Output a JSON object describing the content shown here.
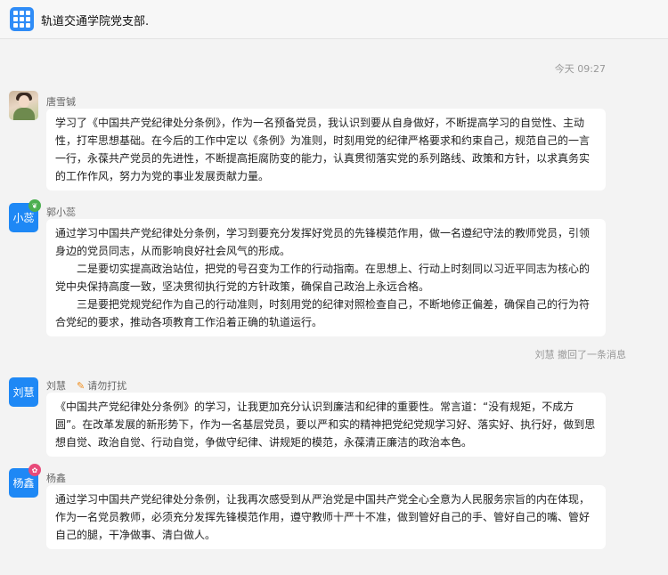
{
  "header": {
    "title": "轨道交通学院党支部.",
    "icon": "group-grid-icon"
  },
  "timestamp": "今天 09:27",
  "messages": [
    {
      "sender": "唐雪铖",
      "avatar_text": "",
      "paragraphs": [
        "学习了《中国共产党纪律处分条例》，作为一名预备党员，我认识到要从自身做好，不断提高学习的自觉性、主动性，打牢思想基础。在今后的工作中定以《条例》为准则，时刻用党的纪律严格要求和约束自己，规范自己的一言一行，永葆共产党员的先进性，不断提高拒腐防变的能力，认真贯彻落实党的系列路线、政策和方针，以求真务实的工作作风，努力为党的事业发展贡献力量。"
      ]
    },
    {
      "sender": "郭小蕊",
      "avatar_text": "小蕊",
      "paragraphs": [
        "通过学习中国共产党纪律处分条例，学习到要充分发挥好党员的先锋模范作用，做一名遵纪守法的教师党员，引领身边的党员同志，从而影响良好社会风气的形成。",
        "二是要切实提高政治站位，把党的号召变为工作的行动指南。在思想上、行动上时刻同以习近平同志为核心的党中央保持高度一致，坚决贯彻执行党的方针政策，确保自己政治上永远合格。",
        "三是要把党规党纪作为自己的行动准则，时刻用党的纪律对照检查自己，不断地修正偏差，确保自己的行为符合党纪的要求，推动各项教育工作沿着正确的轨道运行。"
      ]
    },
    {
      "sender": "刘慧",
      "avatar_text": "刘慧",
      "status": "请勿打扰",
      "paragraphs": [
        "《中国共产党纪律处分条例》的学习，让我更加充分认识到廉洁和纪律的重要性。常言道：“没有规矩，不成方圆”。在改革发展的新形势下，作为一名基层党员，要以严和实的精神把党纪党规学习好、落实好、执行好，做到思想自觉、政治自觉、行动自觉，争做守纪律、讲规矩的模范，永葆清正廉洁的政治本色。"
      ]
    },
    {
      "sender": "杨鑫",
      "avatar_text": "杨鑫",
      "paragraphs": [
        "通过学习中国共产党纪律处分条例，让我再次感受到从严治党是中国共产党全心全意为人民服务宗旨的内在体现，作为一名党员教师，必须充分发挥先锋模范作用，遵守教师十严十不准，做到管好自己的手、管好自己的嘴、管好自己的腿，干净做事、清白做人。"
      ]
    }
  ],
  "recall_notice": "刘慧 撤回了一条消息",
  "colors": {
    "accent": "#1e88f5",
    "background": "#f3f3f3",
    "bubble": "#ffffff",
    "dnd": "#f08c1a"
  }
}
